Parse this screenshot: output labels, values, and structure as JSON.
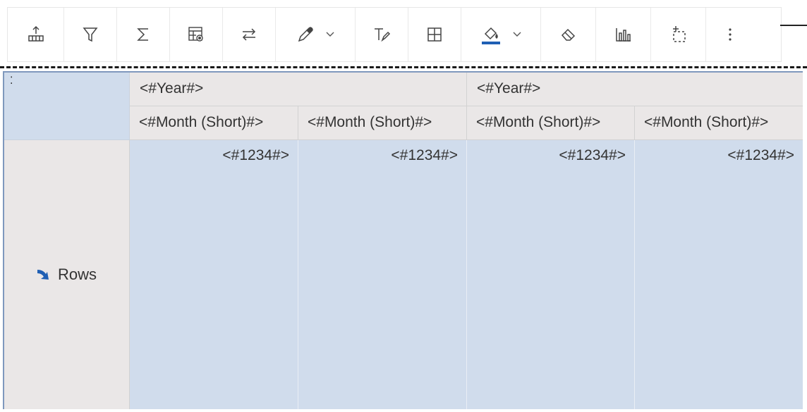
{
  "toolbar": {
    "buttons": [
      {
        "icon": "insert-member-icon"
      },
      {
        "icon": "filter-icon"
      },
      {
        "icon": "summarize-sigma-icon"
      },
      {
        "icon": "table-settings-icon"
      },
      {
        "icon": "swap-rows-columns-icon"
      },
      {
        "icon": "color-picker-icon",
        "dropdown": true
      },
      {
        "icon": "text-style-icon"
      },
      {
        "icon": "borders-icon"
      },
      {
        "icon": "fill-color-icon",
        "dropdown": true,
        "color": "#1f5fb4"
      },
      {
        "icon": "clear-format-icon"
      },
      {
        "icon": "bar-chart-icon"
      },
      {
        "icon": "select-ancestor-icon"
      },
      {
        "icon": "more-vertical-icon"
      }
    ]
  },
  "crosstab": {
    "corner_mark": "⁚",
    "year_headers": [
      "<#Year#>",
      "<#Year#>"
    ],
    "month_headers": [
      "<#Month (Short)#>",
      "<#Month (Short)#>",
      "<#Month (Short)#>",
      "<#Month (Short)#>"
    ],
    "row_label": "Rows",
    "cells": [
      "<#1234#>",
      "<#1234#>",
      "<#1234#>",
      "<#1234#>"
    ],
    "colors": {
      "header_bg": "#eae7e7",
      "data_bg": "#d0dcec",
      "border": "#7f98bd",
      "arrow": "#1f5fb4"
    }
  }
}
